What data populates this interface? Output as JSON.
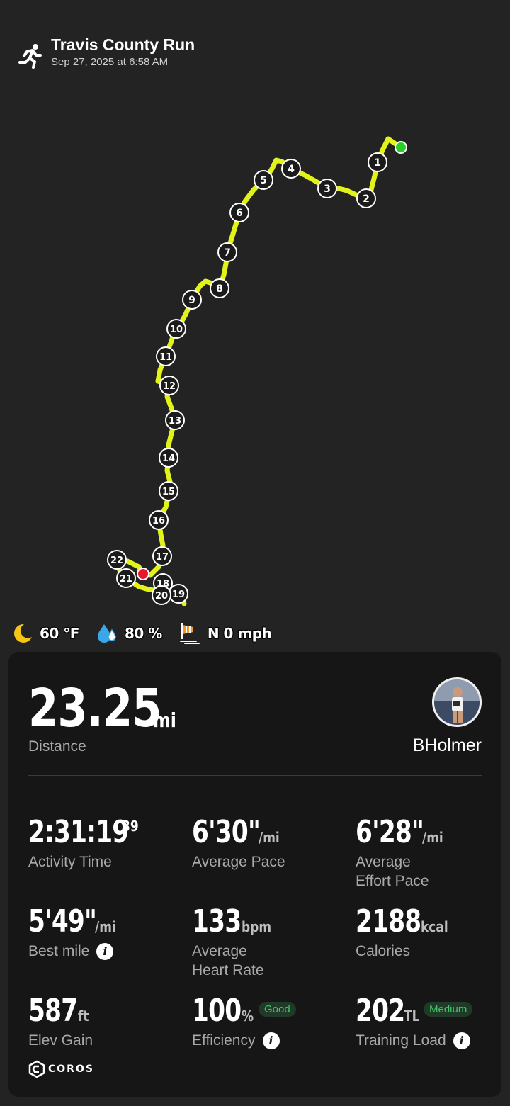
{
  "activity": {
    "title": "Travis County Run",
    "datetime": "Sep 27, 2025 at 6:58 AM",
    "type_icon": "running-person-icon"
  },
  "map": {
    "route_color": "#e2f31a",
    "start_marker_color": "#22d322",
    "end_marker_color": "#e8192c",
    "mile_markers": [
      "1",
      "2",
      "3",
      "4",
      "5",
      "6",
      "7",
      "8",
      "9",
      "10",
      "11",
      "12",
      "13",
      "14",
      "15",
      "16",
      "17",
      "18",
      "19",
      "20",
      "21",
      "22"
    ]
  },
  "weather": {
    "temperature": "60 °F",
    "humidity": "80 %",
    "wind": "N 0 mph",
    "icons": [
      "moon-icon",
      "humidity-drop-icon",
      "wind-sock-icon"
    ]
  },
  "summary": {
    "distance_value": "23.25",
    "distance_unit": "mi",
    "distance_label": "Distance",
    "username": "BHolmer"
  },
  "stats": {
    "activity_time": {
      "value": "2:31:19",
      "fraction": "39",
      "label": "Activity Time"
    },
    "average_pace": {
      "value": "6'30\"",
      "unit": "/mi",
      "label": "Average Pace"
    },
    "effort_pace": {
      "value": "6'28\"",
      "unit": "/mi",
      "label_line1": "Average",
      "label_line2": "Effort Pace"
    },
    "best_mile": {
      "value": "5'49\"",
      "unit": "/mi",
      "label": "Best mile"
    },
    "heart_rate": {
      "value": "133",
      "unit": "bpm",
      "label_line1": "Average",
      "label_line2": "Heart Rate"
    },
    "calories": {
      "value": "2188",
      "unit": "kcal",
      "label": "Calories"
    },
    "elev_gain": {
      "value": "587",
      "unit": "ft",
      "label": "Elev Gain"
    },
    "efficiency": {
      "value": "100",
      "unit": "%",
      "badge": "Good",
      "label": "Efficiency"
    },
    "training_load": {
      "value": "202",
      "unit": "TL",
      "badge": "Medium",
      "label": "Training Load"
    }
  },
  "brand": {
    "name": "COROS"
  }
}
